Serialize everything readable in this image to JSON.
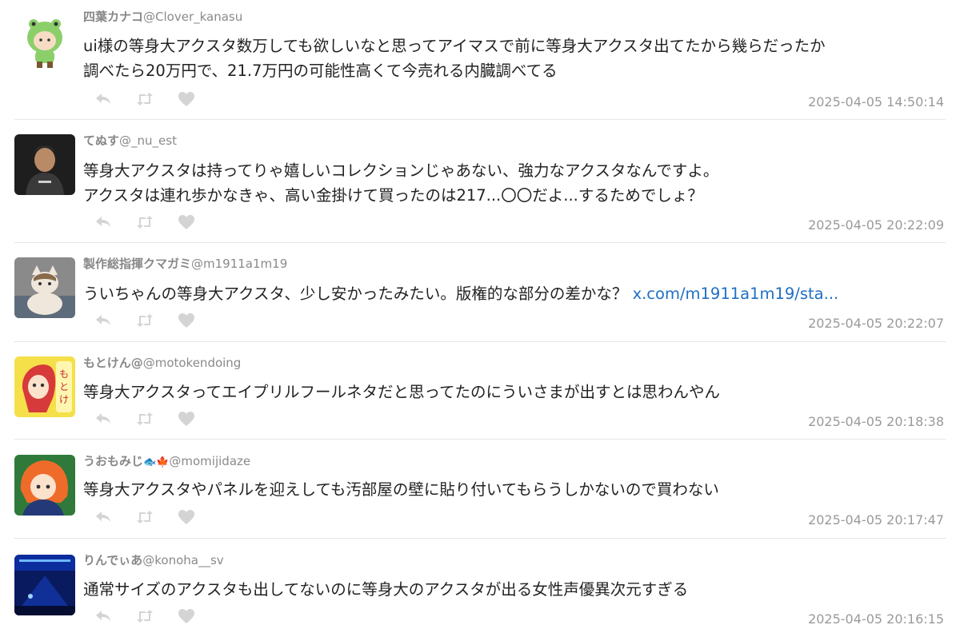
{
  "colors": {
    "link": "#1f6fc5",
    "muted_text": "#9a9a9a",
    "icon": "#d4d4d4",
    "divider": "#e6e6e6"
  },
  "tweets": [
    {
      "name": "四葉カナコ",
      "handle": "@Clover_kanasu",
      "lines": [
        "ui様の等身大アクスタ数万しても欲しいなと思ってアイマスで前に等身大アクスタ出てたから幾らだったか",
        "調べたら20万円で、21.7万円の可能性高くて今売れる内臓調べてる"
      ],
      "timestamp": "2025-04-05 14:50:14"
    },
    {
      "name": "てぬす",
      "handle": "@_nu_est",
      "lines": [
        "等身大アクスタは持ってりゃ嬉しいコレクションじゃあない、強力なアクスタなんですよ。",
        "アクスタは連れ歩かなきゃ、高い金掛けて買ったのは217...〇〇だよ...するためでしょ？"
      ],
      "timestamp": "2025-04-05 20:22:09"
    },
    {
      "name": "製作総指揮クマガミ",
      "handle": "@m1911a1m19",
      "lines": [
        "ういちゃんの等身大アクスタ、少し安かったみたい。版権的な部分の差かな？"
      ],
      "link": "x.com/m1911a1m19/sta...",
      "timestamp": "2025-04-05 20:22:07"
    },
    {
      "name": "もとけん@",
      "handle": "@motokendoing",
      "lines": [
        "等身大アクスタってエイプリルフールネタだと思ってたのにういさまが出すとは思わんやん"
      ],
      "timestamp": "2025-04-05 20:18:38"
    },
    {
      "name": "うおもみじ",
      "emoji": "🐟🍁",
      "handle": "@momijidaze",
      "lines": [
        "等身大アクスタやパネルを迎えしても汚部屋の壁に貼り付いてもらうしかないので買わない"
      ],
      "timestamp": "2025-04-05 20:17:47"
    },
    {
      "name": "りんでぃあ",
      "handle": "@konoha__sv",
      "lines": [
        "通常サイズのアクスタも出してないのに等身大のアクスタが出る女性声優異次元すぎる"
      ],
      "timestamp": "2025-04-05 20:16:15"
    }
  ],
  "icons": {
    "reply": "reply-icon",
    "retweet": "retweet-icon",
    "like": "heart-icon"
  }
}
